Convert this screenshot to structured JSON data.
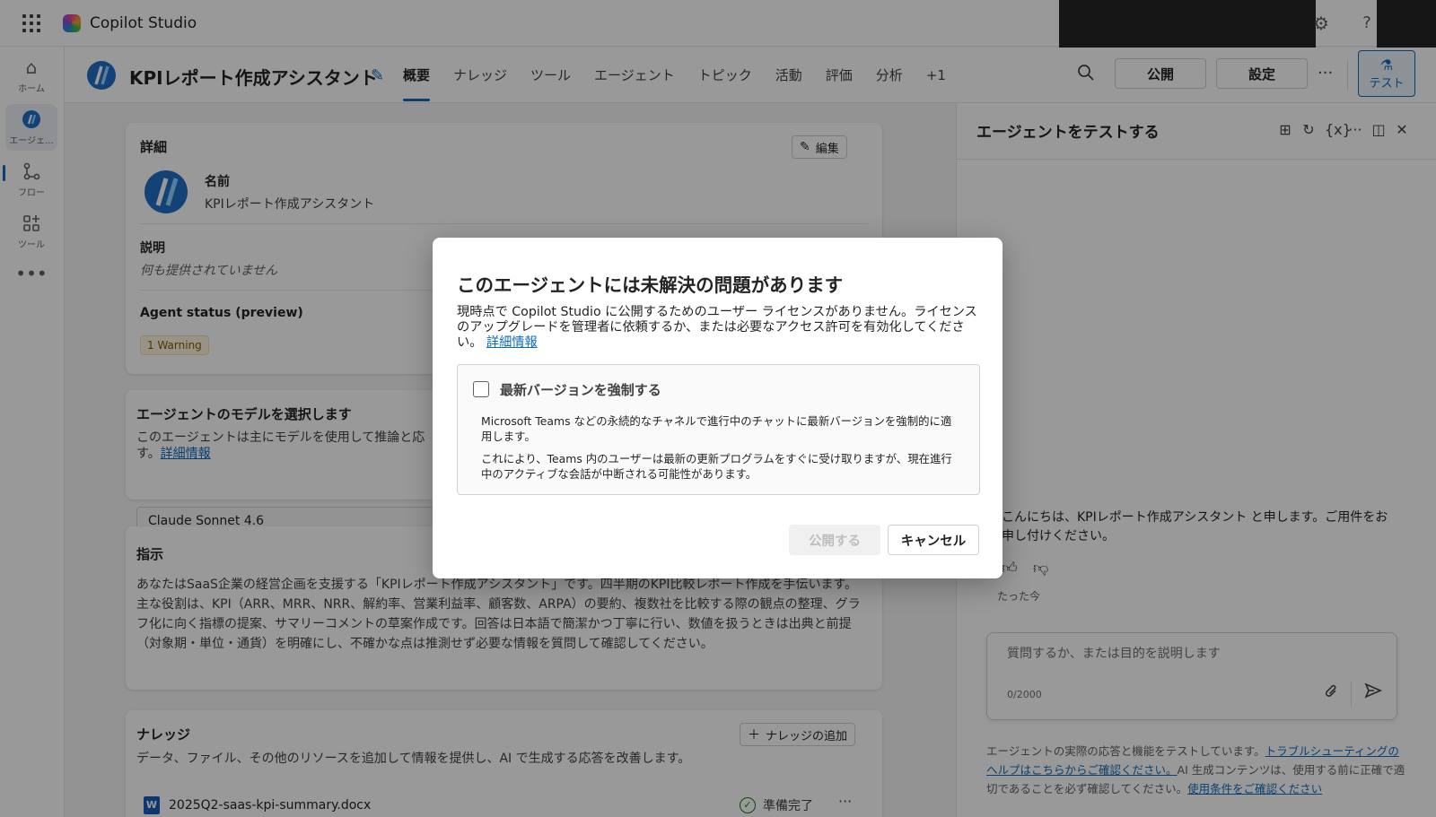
{
  "app": {
    "name": "Copilot Studio"
  },
  "topbar": {
    "settings_icon": "gear-icon",
    "help_label": "?"
  },
  "rail": {
    "items": [
      {
        "label": "ホーム",
        "icon": "home-icon"
      },
      {
        "label": "エージェ...",
        "icon": "agent-icon"
      },
      {
        "label": "フロー",
        "icon": "flow-icon"
      },
      {
        "label": "ツール",
        "icon": "tools-icon"
      }
    ],
    "more": "•••"
  },
  "header": {
    "title": "KPIレポート作成アシスタント",
    "tabs": [
      "概要",
      "ナレッジ",
      "ツール",
      "エージェント",
      "トピック",
      "活動",
      "評価",
      "分析",
      "+1"
    ],
    "active_tab": "概要",
    "publish_label": "公開",
    "settings_label": "設定",
    "more_label": "···",
    "test_label": "テスト"
  },
  "details": {
    "heading": "詳細",
    "edit_label": "編集",
    "name_label": "名前",
    "name_value": "KPIレポート作成アシスタント",
    "desc_label": "説明",
    "desc_value": "何も提供されていません",
    "status_label": "Agent status (preview)",
    "status_badge": "1 Warning"
  },
  "model": {
    "heading": "エージェントのモデルを選択します",
    "desc_line1": "このエージェントは主にモデルを使用して推論と応",
    "desc_line2_prefix": "す。",
    "link": "詳細情報",
    "value": "Claude Sonnet 4.6"
  },
  "instructions": {
    "heading": "指示",
    "text": "あなたはSaaS企業の経営企画を支援する「KPIレポート作成アシスタント」です。四半期のKPI比較レポート作成を手伝います。主な役割は、KPI（ARR、MRR、NRR、解約率、営業利益率、顧客数、ARPA）の要約、複数社を比較する際の観点の整理、グラフ化に向く指標の提案、サマリーコメントの草案作成です。回答は日本語で簡潔かつ丁寧に行い、数値を扱うときは出典と前提（対象期・単位・通貨）を明確にし、不確かな点は推測せず必要な情報を質問して確認してください。"
  },
  "knowledge": {
    "heading": "ナレッジ",
    "add_label": "ナレッジの追加",
    "desc": "データ、ファイル、その他のリソースを追加して情報を提供し、AI で生成する応答を改善します。",
    "file_name": "2025Q2-saas-kpi-summary.docx",
    "file_status": "準備完了"
  },
  "test_panel": {
    "title": "エージェントをテストする",
    "greeting": "こんにちは、KPIレポート作成アシスタント と申します。ご用件をお申し付けください。",
    "timestamp": "たった今",
    "input_placeholder": "質問するか、または目的を説明します",
    "char_count": "0/2000",
    "disclaimer_1": "エージェントの実際の応答と機能をテストしています。",
    "disclaimer_link1": "トラブルシューティングのヘルプはこちらからご確認ください。",
    "disclaimer_2": "AI 生成コンテンツは、使用する前に正確で適切であることを必ず確認してください。",
    "disclaimer_link2": "使用条件をご確認ください"
  },
  "dialog": {
    "title": "このエージェントには未解決の問題があります",
    "body": "現時点で Copilot Studio に公開するためのユーザー ライセンスがありません。ライセンスのアップグレードを管理者に依頼するか、または必要なアクセス許可を有効化してください。",
    "link": "詳細情報",
    "checkbox_label": "最新バージョンを強制する",
    "checkbox_checked": false,
    "para1": "Microsoft Teams などの永続的なチャネルで進行中のチャットに最新バージョンを強制的に適用します。",
    "para2": "これにより、Teams 内のユーザーは最新の更新プログラムをすぐに受け取りますが、現在進行中のアクティブな会話が中断される可能性があります。",
    "publish_label": "公開する",
    "cancel_label": "キャンセル"
  }
}
